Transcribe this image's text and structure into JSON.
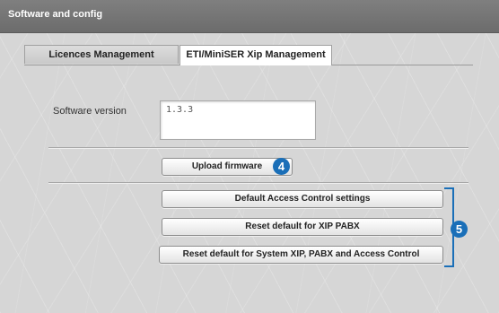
{
  "window": {
    "title": "Software and config"
  },
  "tabs": [
    {
      "label": "Licences Management",
      "active": false
    },
    {
      "label": "ETI/MiniSER Xip Management",
      "active": true
    }
  ],
  "software": {
    "label": "Software version",
    "value": "1.3.3"
  },
  "buttons": {
    "upload": "Upload firmware",
    "default_access": "Default Access Control settings",
    "reset_xip_pabx": "Reset default for XIP PABX",
    "reset_all": "Reset default for System XIP, PABX and Access Control"
  },
  "callouts": {
    "upload": "4",
    "reset_group": "5"
  },
  "colors": {
    "callout": "#1a6fb8",
    "titlebar": "#767676"
  }
}
